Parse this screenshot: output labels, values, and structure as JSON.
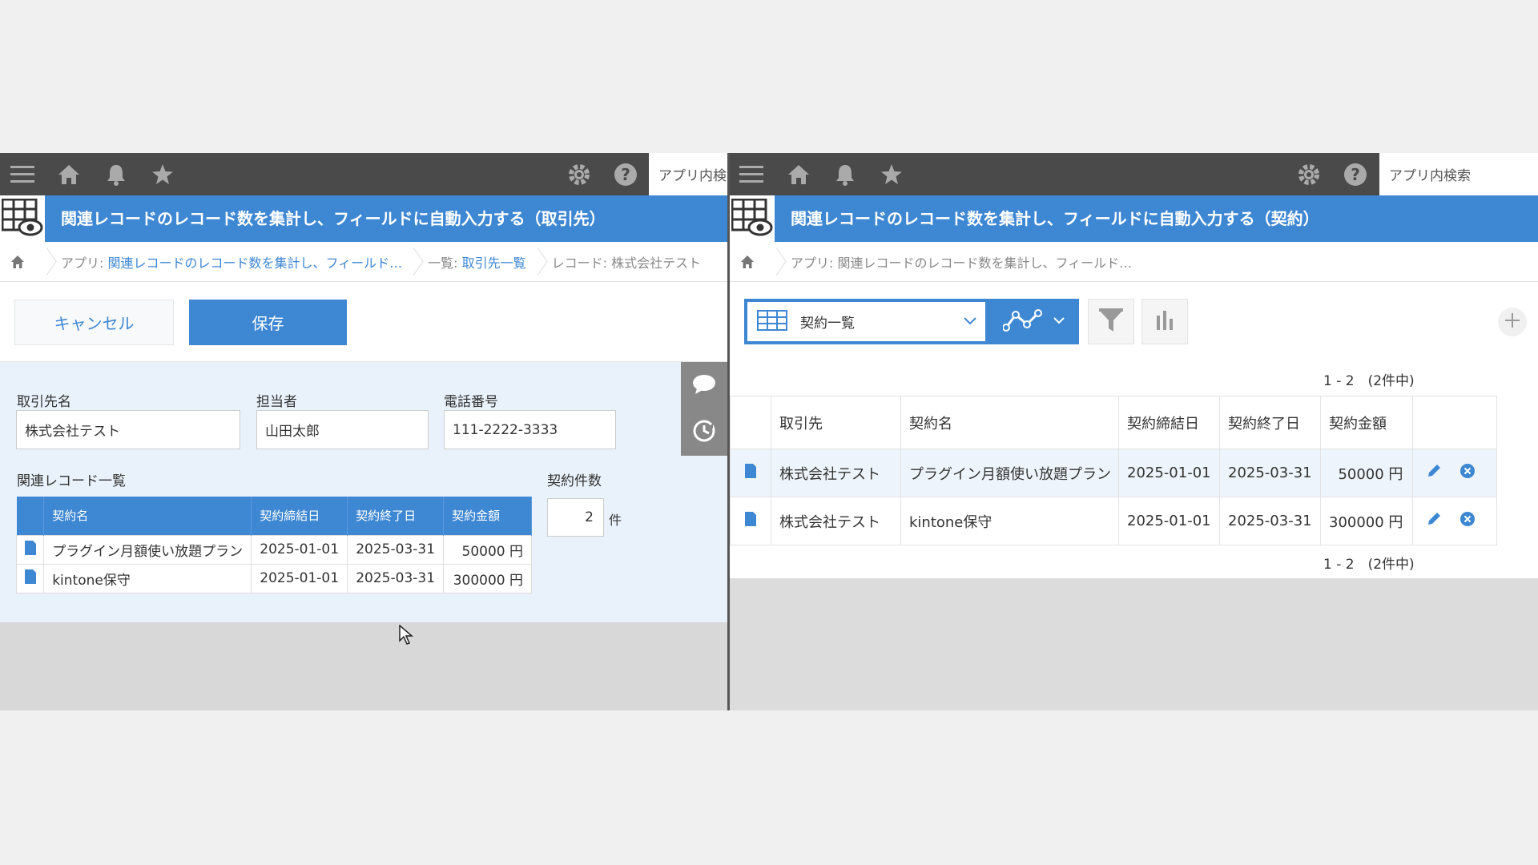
{
  "left": {
    "search_label": "アプリ内検",
    "title": "関連レコードのレコード数を集計し、フィールドに自動入力する（取引先）",
    "breadcrumb": {
      "app_prefix": "アプリ: ",
      "app_link": "関連レコードのレコード数を集計し、フィールド…",
      "list_prefix": "一覧: ",
      "list_link": "取引先一覧",
      "record": "レコード: 株式会社テスト"
    },
    "buttons": {
      "cancel": "キャンセル",
      "save": "保存"
    },
    "fields": {
      "company_label": "取引先名",
      "company_value": "株式会社テスト",
      "person_label": "担当者",
      "person_value": "山田太郎",
      "phone_label": "電話番号",
      "phone_value": "111-2222-3333"
    },
    "related": {
      "label": "関連レコード一覧",
      "headers": [
        "契約名",
        "契約締結日",
        "契約終了日",
        "契約金額"
      ],
      "rows": [
        [
          "プラグイン月額使い放題プラン",
          "2025-01-01",
          "2025-03-31",
          "50000 円"
        ],
        [
          "kintone保守",
          "2025-01-01",
          "2025-03-31",
          "300000 円"
        ]
      ]
    },
    "count": {
      "label": "契約件数",
      "value": "2",
      "unit": "件"
    }
  },
  "right": {
    "search_label": "アプリ内検索",
    "title": "関連レコードのレコード数を集計し、フィールドに自動入力する（契約）",
    "breadcrumb": {
      "app_prefix": "アプリ: ",
      "app_text": "関連レコードのレコード数を集計し、フィールド…"
    },
    "view_name": "契約一覧",
    "pager": "1 - 2　(2件中)",
    "headers": [
      "取引先",
      "契約名",
      "契約締結日",
      "契約終了日",
      "契約金額"
    ],
    "rows": [
      [
        "株式会社テスト",
        "プラグイン月額使い放題プラン",
        "2025-01-01",
        "2025-03-31",
        "50000 円"
      ],
      [
        "株式会社テスト",
        "kintone保守",
        "2025-01-01",
        "2025-03-31",
        "300000 円"
      ]
    ]
  },
  "colors": {
    "accent": "#3e87d3",
    "header_bar": "#4a4a4a",
    "form_bg": "#e9f2fb"
  },
  "icons": [
    "menu-icon",
    "home-icon",
    "bell-icon",
    "star-icon",
    "gear-icon",
    "help-icon",
    "app-icon",
    "document-icon",
    "comment-icon",
    "history-icon",
    "table-view-icon",
    "graph-icon",
    "filter-icon",
    "bar-chart-icon",
    "plus-icon",
    "edit-icon",
    "delete-icon",
    "cursor-icon"
  ]
}
